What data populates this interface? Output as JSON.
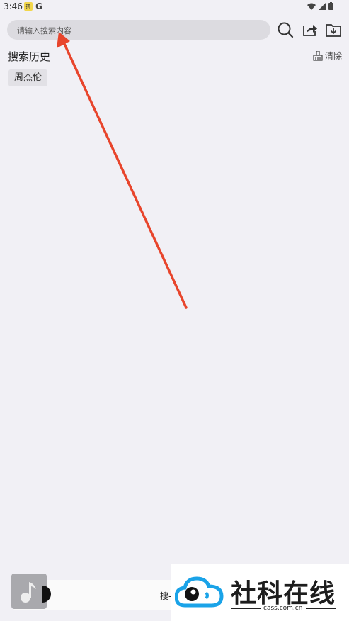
{
  "status_bar": {
    "time": "3:46",
    "pinyin_badge": "拼",
    "g_label": "G",
    "icons": [
      "wifi-icon",
      "signal-icon",
      "battery-icon"
    ]
  },
  "search": {
    "placeholder": "请输入搜索内容",
    "icons": [
      "search-icon",
      "share-icon",
      "download-folder-icon"
    ]
  },
  "history": {
    "title": "搜索历史",
    "clear_label": "清除",
    "items": [
      "周杰伦"
    ]
  },
  "player": {
    "text": "搜-"
  },
  "watermark": {
    "title": "社科在线",
    "subtitle": "cass.com.cn"
  },
  "colors": {
    "background": "#f1f0f5",
    "search_bar": "#dcdbe0",
    "annotation_arrow": "#e8452c",
    "watermark_blue": "#1aa3e8"
  }
}
